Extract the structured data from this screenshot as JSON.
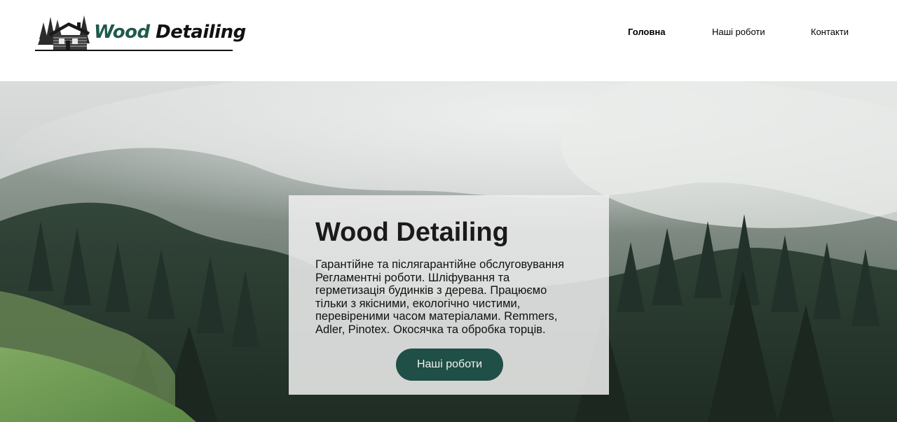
{
  "brand": {
    "name_part1": "Wood",
    "name_part2": "Detailing",
    "logo_icon": "log-cabin-with-trees-icon",
    "colors": {
      "accent": "#1f5a4c",
      "text": "#111111"
    }
  },
  "nav": {
    "items": [
      {
        "label": "Головна",
        "active": true
      },
      {
        "label": "Наші роботи",
        "active": false
      },
      {
        "label": "Контакти",
        "active": false
      }
    ]
  },
  "hero": {
    "background": "misty-forest-hillside-photo",
    "title": "Wood Detailing",
    "description": "Гарантійне та післягарантійне обслуговування Регламентні роботи. Шліфування та герметизація будинків з дерева. Працюємо тільки з якісними, екологічно чистими, перевіреними часом матеріалами. Remmers, Adler, Pinotex. Окосячка та обробка торців.",
    "button_label": "Наші роботи",
    "colors": {
      "button_bg": "#1f4f46",
      "card_bg": "rgba(240,240,240,0.86)"
    }
  }
}
